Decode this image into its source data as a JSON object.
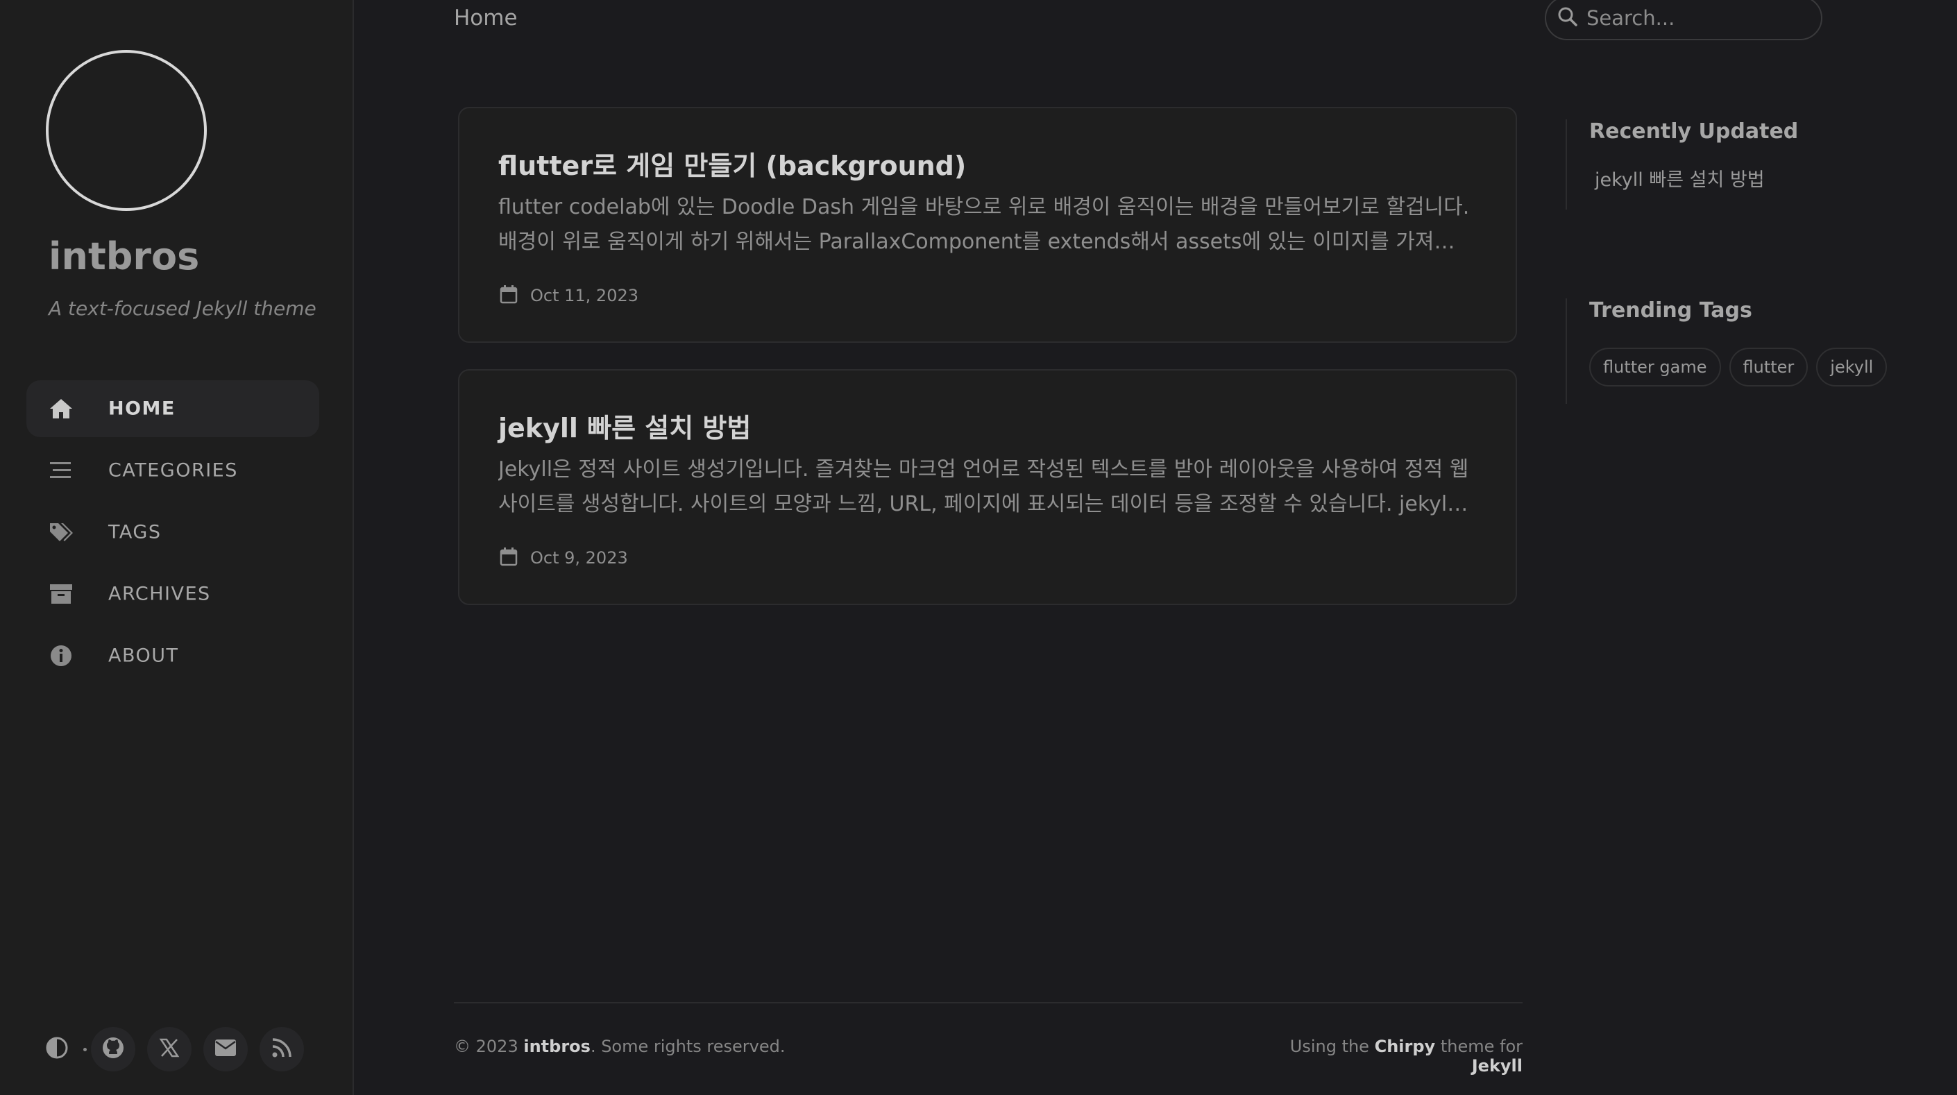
{
  "sidebar": {
    "title": "intbros",
    "subtitle": "A text-focused Jekyll theme",
    "nav": [
      {
        "label": "HOME",
        "icon": "home-icon",
        "active": true
      },
      {
        "label": "CATEGORIES",
        "icon": "stream-icon",
        "active": false
      },
      {
        "label": "TAGS",
        "icon": "tags-icon",
        "active": false
      },
      {
        "label": "ARCHIVES",
        "icon": "archive-icon",
        "active": false
      },
      {
        "label": "ABOUT",
        "icon": "info-circle-icon",
        "active": false
      }
    ],
    "bottom_icons": [
      "theme-toggle-icon",
      "github-icon",
      "x-twitter-icon",
      "email-icon",
      "rss-icon"
    ]
  },
  "topbar": {
    "breadcrumb": "Home",
    "search_placeholder": "Search..."
  },
  "posts": [
    {
      "title": "flutter로 게임 만들기 (background)",
      "excerpt": "flutter codelab에 있는 Doodle Dash 게임을 바탕으로 위로 배경이 움직이는 배경을 만들어보기로 할겁니다. 배경이 위로 움직이게 하기 위해서는 ParallaxComponent를 extends해서 assets에 있는 이미지를 가져와 레이…",
      "date": "Oct 11, 2023"
    },
    {
      "title": "jekyll 빠른 설치 방법",
      "excerpt": "Jekyll은 정적 사이트 생성기입니다. 즐겨찾는 마크업 언어로 작성된 텍스트를 받아 레이아웃을 사용하여 정적 웹사이트를 생성합니다. 사이트의 모양과 느낌, URL, 페이지에 표시되는 데이터 등을 조정할 수 있습니다. jekyll …",
      "date": "Oct 9, 2023"
    }
  ],
  "panel": {
    "recent_heading": "Recently Updated",
    "recent_items": [
      "jekyll 빠른 설치 방법"
    ],
    "tags_heading": "Trending Tags",
    "tags": [
      "flutter game",
      "flutter",
      "jekyll"
    ]
  },
  "footer": {
    "copyright_prefix": "© 2023",
    "owner": "intbros",
    "copyright_suffix": ". Some rights reserved.",
    "using_prefix": "Using the",
    "theme_name": "Chirpy",
    "theme_mid": "theme for",
    "engine": "Jekyll"
  },
  "colors": {
    "background": "#1b1b1e",
    "sidebar": "#1e1e1e",
    "card": "#1e1e1e",
    "active_nav": "#262628"
  }
}
